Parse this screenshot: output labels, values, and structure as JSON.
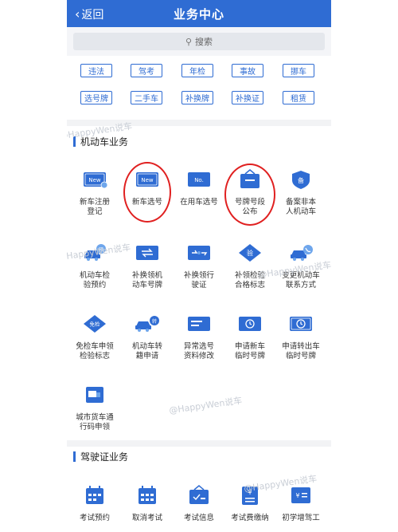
{
  "nav": {
    "back_label": "返回",
    "title": "业务中心"
  },
  "search": {
    "placeholder": "搜索"
  },
  "quick_row1": [
    "违法",
    "驾考",
    "年检",
    "事故",
    "挪车"
  ],
  "quick_row2": [
    "选号牌",
    "二手车",
    "补换牌",
    "补换证",
    "租赁"
  ],
  "section1": {
    "title": "机动车业务",
    "tiles": [
      {
        "label": "新车注册\n登记",
        "badge": "New"
      },
      {
        "label": "新车选号",
        "badge": "New"
      },
      {
        "label": "在用车选号",
        "badge": "No."
      },
      {
        "label": "号牌号段\n公布",
        "badge": ""
      },
      {
        "label": "备案非本\n人机动车",
        "badge": "备"
      },
      {
        "label": "机动车检\n验预约",
        "badge": "预"
      },
      {
        "label": "补换领机\n动车号牌",
        "badge": ""
      },
      {
        "label": "补换领行\n驶证",
        "badge": ""
      },
      {
        "label": "补领检验\n合格标志",
        "badge": "验"
      },
      {
        "label": "变更机动车\n联系方式",
        "badge": ""
      },
      {
        "label": "免检车申领\n检验标志",
        "badge": "免检"
      },
      {
        "label": "机动车转\n籍申请",
        "badge": "转"
      },
      {
        "label": "异常选号\n资料修改",
        "badge": ""
      },
      {
        "label": "申请新车\n临时号牌",
        "badge": ""
      },
      {
        "label": "申请转出车\n临时号牌",
        "badge": ""
      },
      {
        "label": "城市货车通\n行码申领",
        "badge": ""
      }
    ]
  },
  "section2": {
    "title": "驾驶证业务",
    "tiles": [
      {
        "label": "考试预约",
        "badge": ""
      },
      {
        "label": "取消考试",
        "badge": ""
      },
      {
        "label": "考试信息",
        "badge": ""
      },
      {
        "label": "考试费缴纳",
        "badge": "¥"
      },
      {
        "label": "初学增驾工",
        "badge": "¥"
      }
    ]
  },
  "watermarks": [
    "@HappyWen说车",
    "@HappyWen说车",
    "@HappyWen说车",
    "@HappyWen说车",
    "@HappyWen说车"
  ],
  "colors": {
    "brand": "#2f6cd3",
    "icon_light": "#6ea6ec",
    "annotation": "#e02020"
  }
}
